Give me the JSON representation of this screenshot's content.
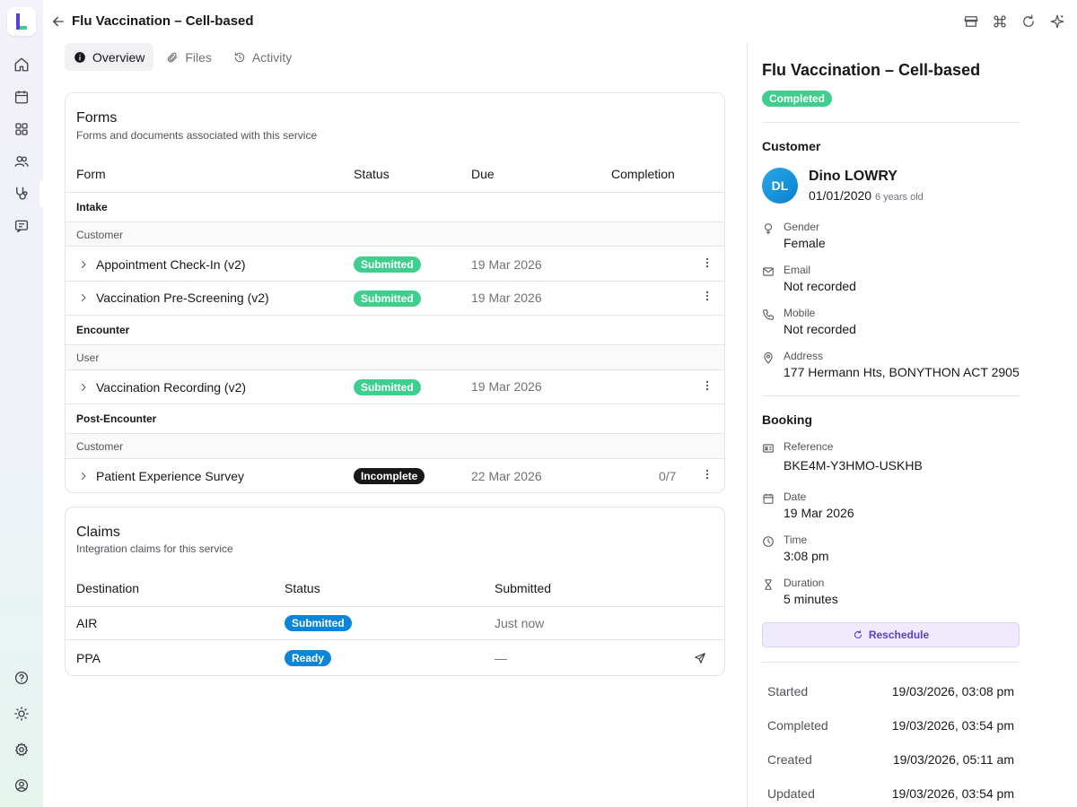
{
  "header": {
    "title": "Flu Vaccination – Cell-based"
  },
  "tabs": [
    {
      "label": "Overview"
    },
    {
      "label": "Files"
    },
    {
      "label": "Activity"
    }
  ],
  "forms": {
    "title": "Forms",
    "subtitle": "Forms and documents associated with this service",
    "columns": [
      "Form",
      "Status",
      "Due",
      "Completion"
    ],
    "groups": [
      {
        "name": "Intake",
        "subgroup": "Customer"
      },
      {
        "name": "Encounter",
        "subgroup": "User"
      },
      {
        "name": "Post-Encounter",
        "subgroup": "Customer"
      }
    ],
    "rows": [
      {
        "name": "Appointment Check-In (v2)",
        "status": "Submitted",
        "due": "19 Mar 2026",
        "completion": ""
      },
      {
        "name": "Vaccination Pre-Screening (v2)",
        "status": "Submitted",
        "due": "19 Mar 2026",
        "completion": ""
      },
      {
        "name": "Vaccination Recording (v2)",
        "status": "Submitted",
        "due": "19 Mar 2026",
        "completion": ""
      },
      {
        "name": "Patient Experience Survey",
        "status": "Incomplete",
        "due": "22 Mar 2026",
        "completion": "0/7"
      }
    ]
  },
  "claims": {
    "title": "Claims",
    "subtitle": "Integration claims for this service",
    "columns": [
      "Destination",
      "Status",
      "Submitted"
    ],
    "rows": [
      {
        "destination": "AIR",
        "status": "Submitted",
        "submitted": "Just now"
      },
      {
        "destination": "PPA",
        "status": "Ready",
        "submitted": "—"
      }
    ]
  },
  "panel": {
    "title": "Flu Vaccination – Cell-based",
    "status": "Completed",
    "customer": {
      "section": "Customer",
      "initials": "DL",
      "name": "Dino LOWRY",
      "dob": "01/01/2020",
      "age": "6 years old",
      "gender_label": "Gender",
      "gender": "Female",
      "email_label": "Email",
      "email": "Not recorded",
      "mobile_label": "Mobile",
      "mobile": "Not recorded",
      "address_label": "Address",
      "address": "177 Hermann Hts, BONYTHON ACT 2905"
    },
    "booking": {
      "section": "Booking",
      "reference_label": "Reference",
      "reference": "BKE4M-Y3HMO-USKHB",
      "date_label": "Date",
      "date": "19 Mar 2026",
      "time_label": "Time",
      "time": "3:08 pm",
      "duration_label": "Duration",
      "duration": "5 minutes",
      "reschedule_label": "Reschedule"
    },
    "timestamps": [
      {
        "label": "Started",
        "value": "19/03/2026, 03:08 pm"
      },
      {
        "label": "Completed",
        "value": "19/03/2026, 03:54 pm"
      },
      {
        "label": "Created",
        "value": "19/03/2026, 05:11 am"
      },
      {
        "label": "Updated",
        "value": "19/03/2026, 03:54 pm"
      }
    ]
  },
  "colors": {
    "success": "#3ecf8e",
    "info": "#0a85d9",
    "dark": "#18181b",
    "accent": "#5b3fd1"
  },
  "icons": {
    "rail": [
      "home-icon",
      "calendar-icon",
      "grid-icon",
      "users-icon",
      "stethoscope-icon",
      "message-icon",
      "help-icon",
      "sun-icon",
      "gear-icon",
      "user-circle-icon"
    ],
    "header": [
      "back-arrow-icon",
      "store-icon",
      "command-icon",
      "refresh-icon",
      "sparkle-icon"
    ]
  }
}
